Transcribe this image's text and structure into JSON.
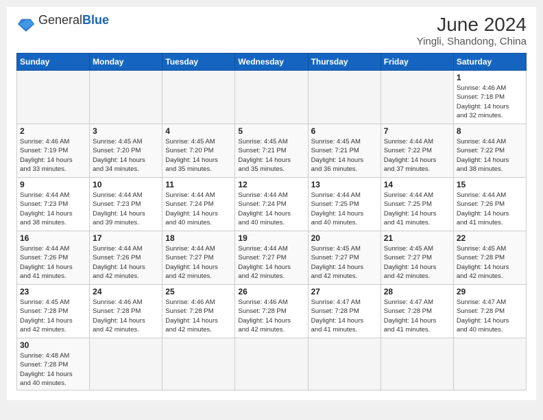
{
  "header": {
    "logo_general": "General",
    "logo_blue": "Blue",
    "month_year": "June 2024",
    "location": "Yingli, Shandong, China"
  },
  "weekdays": [
    "Sunday",
    "Monday",
    "Tuesday",
    "Wednesday",
    "Thursday",
    "Friday",
    "Saturday"
  ],
  "weeks": [
    [
      {
        "day": "",
        "info": ""
      },
      {
        "day": "",
        "info": ""
      },
      {
        "day": "",
        "info": ""
      },
      {
        "day": "",
        "info": ""
      },
      {
        "day": "",
        "info": ""
      },
      {
        "day": "",
        "info": ""
      },
      {
        "day": "1",
        "info": "Sunrise: 4:46 AM\nSunset: 7:18 PM\nDaylight: 14 hours\nand 32 minutes."
      }
    ],
    [
      {
        "day": "2",
        "info": "Sunrise: 4:46 AM\nSunset: 7:19 PM\nDaylight: 14 hours\nand 33 minutes."
      },
      {
        "day": "3",
        "info": "Sunrise: 4:45 AM\nSunset: 7:20 PM\nDaylight: 14 hours\nand 34 minutes."
      },
      {
        "day": "4",
        "info": "Sunrise: 4:45 AM\nSunset: 7:20 PM\nDaylight: 14 hours\nand 35 minutes."
      },
      {
        "day": "5",
        "info": "Sunrise: 4:45 AM\nSunset: 7:21 PM\nDaylight: 14 hours\nand 35 minutes."
      },
      {
        "day": "6",
        "info": "Sunrise: 4:45 AM\nSunset: 7:21 PM\nDaylight: 14 hours\nand 36 minutes."
      },
      {
        "day": "7",
        "info": "Sunrise: 4:44 AM\nSunset: 7:22 PM\nDaylight: 14 hours\nand 37 minutes."
      },
      {
        "day": "8",
        "info": "Sunrise: 4:44 AM\nSunset: 7:22 PM\nDaylight: 14 hours\nand 38 minutes."
      }
    ],
    [
      {
        "day": "9",
        "info": "Sunrise: 4:44 AM\nSunset: 7:23 PM\nDaylight: 14 hours\nand 38 minutes."
      },
      {
        "day": "10",
        "info": "Sunrise: 4:44 AM\nSunset: 7:23 PM\nDaylight: 14 hours\nand 39 minutes."
      },
      {
        "day": "11",
        "info": "Sunrise: 4:44 AM\nSunset: 7:24 PM\nDaylight: 14 hours\nand 40 minutes."
      },
      {
        "day": "12",
        "info": "Sunrise: 4:44 AM\nSunset: 7:24 PM\nDaylight: 14 hours\nand 40 minutes."
      },
      {
        "day": "13",
        "info": "Sunrise: 4:44 AM\nSunset: 7:25 PM\nDaylight: 14 hours\nand 40 minutes."
      },
      {
        "day": "14",
        "info": "Sunrise: 4:44 AM\nSunset: 7:25 PM\nDaylight: 14 hours\nand 41 minutes."
      },
      {
        "day": "15",
        "info": "Sunrise: 4:44 AM\nSunset: 7:26 PM\nDaylight: 14 hours\nand 41 minutes."
      }
    ],
    [
      {
        "day": "16",
        "info": "Sunrise: 4:44 AM\nSunset: 7:26 PM\nDaylight: 14 hours\nand 41 minutes."
      },
      {
        "day": "17",
        "info": "Sunrise: 4:44 AM\nSunset: 7:26 PM\nDaylight: 14 hours\nand 42 minutes."
      },
      {
        "day": "18",
        "info": "Sunrise: 4:44 AM\nSunset: 7:27 PM\nDaylight: 14 hours\nand 42 minutes."
      },
      {
        "day": "19",
        "info": "Sunrise: 4:44 AM\nSunset: 7:27 PM\nDaylight: 14 hours\nand 42 minutes."
      },
      {
        "day": "20",
        "info": "Sunrise: 4:45 AM\nSunset: 7:27 PM\nDaylight: 14 hours\nand 42 minutes."
      },
      {
        "day": "21",
        "info": "Sunrise: 4:45 AM\nSunset: 7:27 PM\nDaylight: 14 hours\nand 42 minutes."
      },
      {
        "day": "22",
        "info": "Sunrise: 4:45 AM\nSunset: 7:28 PM\nDaylight: 14 hours\nand 42 minutes."
      }
    ],
    [
      {
        "day": "23",
        "info": "Sunrise: 4:45 AM\nSunset: 7:28 PM\nDaylight: 14 hours\nand 42 minutes."
      },
      {
        "day": "24",
        "info": "Sunrise: 4:46 AM\nSunset: 7:28 PM\nDaylight: 14 hours\nand 42 minutes."
      },
      {
        "day": "25",
        "info": "Sunrise: 4:46 AM\nSunset: 7:28 PM\nDaylight: 14 hours\nand 42 minutes."
      },
      {
        "day": "26",
        "info": "Sunrise: 4:46 AM\nSunset: 7:28 PM\nDaylight: 14 hours\nand 42 minutes."
      },
      {
        "day": "27",
        "info": "Sunrise: 4:47 AM\nSunset: 7:28 PM\nDaylight: 14 hours\nand 41 minutes."
      },
      {
        "day": "28",
        "info": "Sunrise: 4:47 AM\nSunset: 7:28 PM\nDaylight: 14 hours\nand 41 minutes."
      },
      {
        "day": "29",
        "info": "Sunrise: 4:47 AM\nSunset: 7:28 PM\nDaylight: 14 hours\nand 40 minutes."
      }
    ],
    [
      {
        "day": "30",
        "info": "Sunrise: 4:48 AM\nSunset: 7:28 PM\nDaylight: 14 hours\nand 40 minutes."
      },
      {
        "day": "",
        "info": ""
      },
      {
        "day": "",
        "info": ""
      },
      {
        "day": "",
        "info": ""
      },
      {
        "day": "",
        "info": ""
      },
      {
        "day": "",
        "info": ""
      },
      {
        "day": "",
        "info": ""
      }
    ]
  ]
}
